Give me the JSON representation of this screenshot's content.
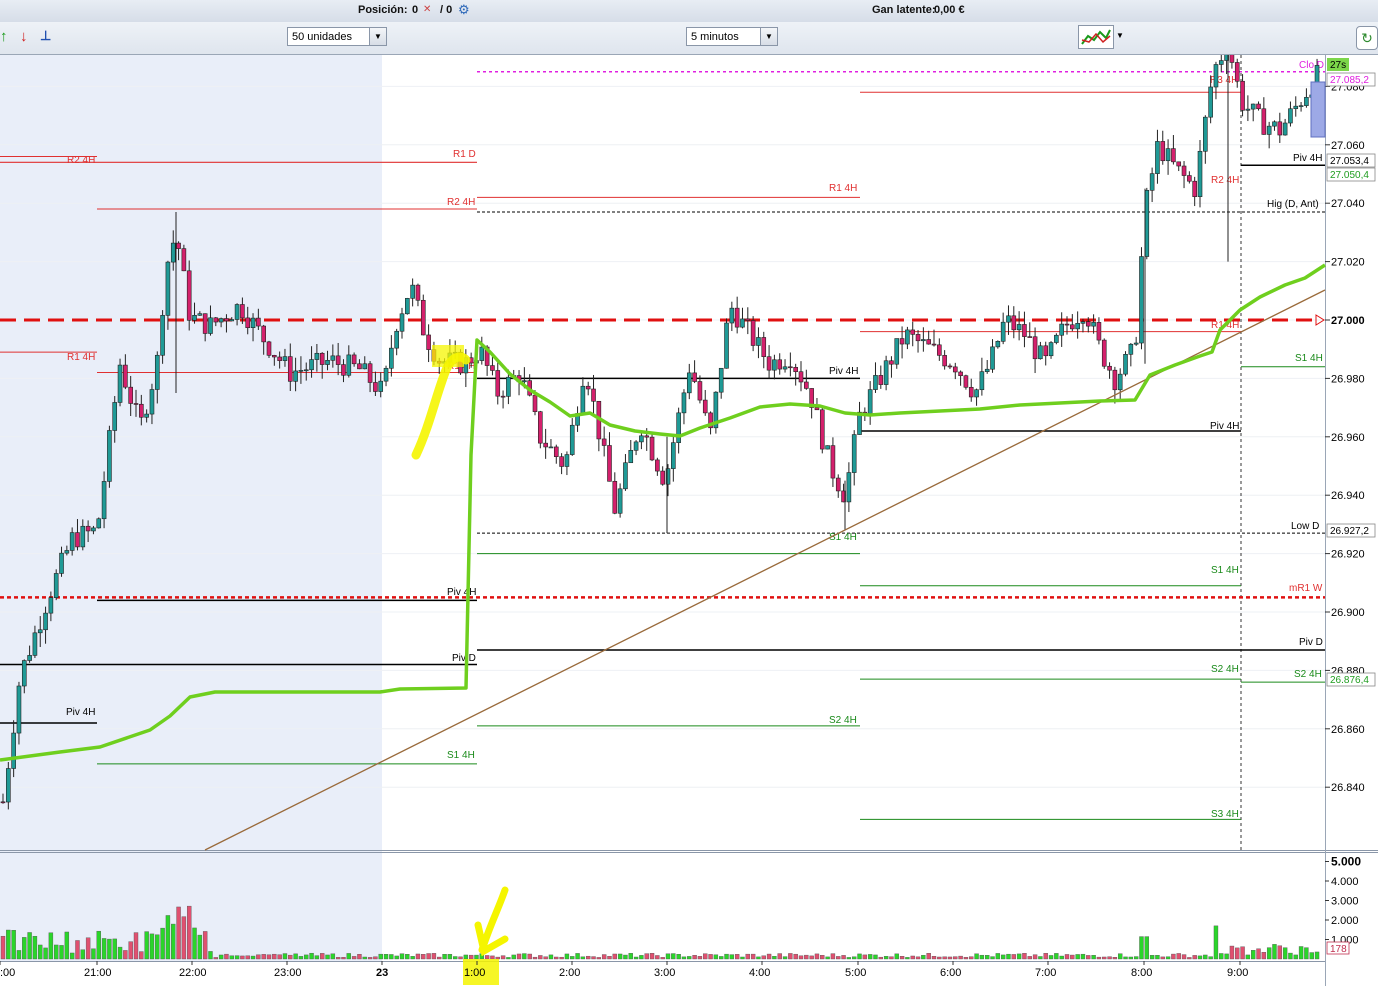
{
  "header": {
    "position_label": "Posición:",
    "position_value": "0",
    "position_value2": "/ 0",
    "pl_label": "Gan latente:",
    "pl_value": "0,00 €"
  },
  "toolbar": {
    "units_select": "50 unidades",
    "interval_select": "5 minutos"
  },
  "price_axis": {
    "ticks": [
      "27.080",
      "27.060",
      "27.040",
      "27.020",
      "27.000",
      "26.980",
      "26.960",
      "26.940",
      "26.920",
      "26.900",
      "26.880",
      "26.860",
      "26.840"
    ],
    "badges": [
      {
        "text": "27s",
        "fg": "#000000",
        "bg": "#7cd64a"
      },
      {
        "text": "27.085,2",
        "fg": "#e020e0",
        "bg": "#ffffff"
      },
      {
        "text": "27.053,4",
        "fg": "#000000",
        "bg": "#ffffff"
      },
      {
        "text": "27.050,4",
        "fg": "#1f9d1f",
        "bg": "#ffffff"
      },
      {
        "text": "26.927,2",
        "fg": "#000000",
        "bg": "#ffffff"
      },
      {
        "text": "26.876,4",
        "fg": "#1f9d1f",
        "bg": "#ffffff"
      }
    ]
  },
  "volume_axis": {
    "ticks": [
      "5.000",
      "4.000",
      "3.000",
      "2.000",
      "1.000"
    ],
    "badge": "178"
  },
  "time_axis": {
    "labels": [
      ":00",
      "21:00",
      "22:00",
      "23:00",
      "23",
      "1:00",
      "2:00",
      "3:00",
      "4:00",
      "5:00",
      "6:00",
      "7:00",
      "8:00",
      "9:00"
    ]
  },
  "level_labels": [
    "R2 4H",
    "R1 D",
    "R2 4H",
    "R1 4H",
    "R3 4H",
    "R2 4H",
    "Clo D",
    "Piv 4H",
    "Hig (D, Ant)",
    "R1 4H",
    "R1 4H",
    "R1 4H",
    "Piv 4H",
    "S1 4H",
    "Piv 4H",
    "Low D",
    "S1 4H",
    "S1 4H",
    "Piv 4H",
    "mR1 W",
    "Piv D",
    "Piv D",
    "S2 4H",
    "S2 4H",
    "Piv 4H",
    "S2 4H",
    "S1 4H",
    "S3 4H"
  ],
  "chart_data": {
    "type": "candlestick",
    "instrument_timeframe": "5 minutos",
    "y_range": [
      26.82,
      27.09
    ],
    "x_labels": [
      ":00",
      "21:00",
      "22:00",
      "23:00",
      "23",
      "1:00",
      "2:00",
      "3:00",
      "4:00",
      "5:00",
      "6:00",
      "7:00",
      "8:00",
      "9:00"
    ],
    "price_levels": [
      {
        "label": "R1 D",
        "value": 27.054
      },
      {
        "label": "Hig (D, Ant)",
        "value": 27.038
      },
      {
        "label": "Clo D",
        "value": 27.085
      },
      {
        "label": "Low D",
        "value": 26.927
      },
      {
        "label": "mR1 W",
        "value": 26.905
      },
      {
        "label": "Piv D",
        "value": 26.882
      },
      {
        "label": "Piv D",
        "value": 26.887
      }
    ],
    "ohlc_key_points": [
      {
        "time": "21:30",
        "close": 27.0
      },
      {
        "time": "22:00",
        "high": 27.037
      },
      {
        "time": "0:30",
        "high": 27.017
      },
      {
        "time": "2:00",
        "low": 26.933
      },
      {
        "time": "4:45",
        "low": 26.93
      },
      {
        "time": "8:00",
        "close": 27.065
      },
      {
        "time": "9:45",
        "close": 27.085
      }
    ],
    "volume_max": 5000,
    "colors": {
      "up": "#1f9a96",
      "down": "#d4206c",
      "ma": "#6fcf1e",
      "dashed_red": "#e01010",
      "trend": "#9a6b3c"
    }
  }
}
